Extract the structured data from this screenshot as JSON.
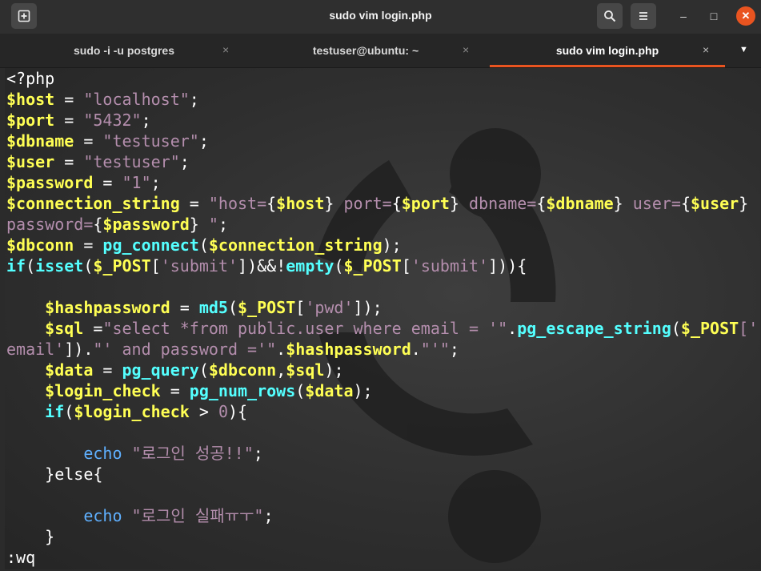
{
  "window": {
    "title": "sudo vim login.php",
    "new_tab_icon": "new-tab-icon",
    "search_icon": "search-icon",
    "menu_icon": "hamburger-icon",
    "minimize_glyph": "–",
    "maximize_glyph": "□",
    "close_glyph": "✕",
    "accent_color": "#e95420"
  },
  "tabs": [
    {
      "label": "sudo -i -u postgres",
      "active": false
    },
    {
      "label": "testuser@ubuntu: ~",
      "active": false
    },
    {
      "label": "sudo vim login.php",
      "active": true
    }
  ],
  "tab_close_glyph": "×",
  "tab_menu_glyph": "▼",
  "code": {
    "l01": {
      "a": "<?php"
    },
    "l02": {
      "a": "$host",
      "b": " = ",
      "c": "\"localhost\"",
      "d": ";"
    },
    "l03": {
      "a": "$port",
      "b": " = ",
      "c": "\"5432\"",
      "d": ";"
    },
    "l04": {
      "a": "$dbname",
      "b": " = ",
      "c": "\"testuser\"",
      "d": ";"
    },
    "l05": {
      "a": "$user",
      "b": " = ",
      "c": "\"testuser\"",
      "d": ";"
    },
    "l06": {
      "a": "$password",
      "b": " = ",
      "c": "\"1\"",
      "d": ";"
    },
    "l07": {
      "a": "$connection_string",
      "b": " = ",
      "c": "\"host=",
      "d": "{",
      "e": "$host",
      "f": "}",
      "g": " port=",
      "h": "{",
      "i": "$port",
      "j": "}",
      "k": " dbname=",
      "l": "{",
      "m": "$dbname",
      "n": "}",
      "o": " user=",
      "p": "{",
      "q": "$user",
      "r": "}"
    },
    "l08": {
      "a": "password=",
      "b": "{",
      "c": "$password",
      "d": "}",
      "e": " \"",
      "f": ";"
    },
    "l09": {
      "a": "$dbconn",
      "b": " = ",
      "c": "pg_connect",
      "d": "(",
      "e": "$connection_string",
      "f": ");"
    },
    "l10": {
      "a": "if",
      "b": "(",
      "c": "isset",
      "d": "(",
      "e": "$_POST",
      "f": "[",
      "g": "'submit'",
      "h": "])&&!",
      "i": "empty",
      "j": "(",
      "k": "$_POST",
      "l": "[",
      "m": "'submit'",
      "n": "])){"
    },
    "l12": {
      "a": "    ",
      "b": "$hashpassword",
      "c": " = ",
      "d": "md5",
      "e": "(",
      "f": "$_POST",
      "g": "[",
      "h": "'pwd'",
      "i": "]);"
    },
    "l13": {
      "a": "    ",
      "b": "$sql",
      "c": " =",
      "d": "\"select *from public.user where email = '\"",
      "e": ".",
      "f": "pg_escape_string",
      "g": "(",
      "h": "$_POST",
      "i": "['"
    },
    "l14": {
      "a": "email'",
      "b": "]).",
      "c": "\"' and password ='\"",
      "d": ".",
      "e": "$hashpassword",
      "f": ".",
      "g": "\"'\"",
      "h": ";"
    },
    "l15": {
      "a": "    ",
      "b": "$data",
      "c": " = ",
      "d": "pg_query",
      "e": "(",
      "f": "$dbconn",
      "g": ",",
      "h": "$sql",
      "i": ");"
    },
    "l16": {
      "a": "    ",
      "b": "$login_check",
      "c": " = ",
      "d": "pg_num_rows",
      "e": "(",
      "f": "$data",
      "g": ");"
    },
    "l17": {
      "a": "    ",
      "b": "if",
      "c": "(",
      "d": "$login_check",
      "e": " > ",
      "f": "0",
      "g": "){"
    },
    "l19": {
      "a": "        ",
      "b": "echo",
      "c": " ",
      "d": "\"로그인 성공!!\"",
      "e": ";"
    },
    "l20": {
      "a": "    ",
      "b": "}else{"
    },
    "l22": {
      "a": "        ",
      "b": "echo",
      "c": " ",
      "d": "\"로그인 실패ㅠㅜ\"",
      "e": ";"
    },
    "l23": {
      "a": "    ",
      "b": "}"
    },
    "l24": {
      "a": ":wq"
    }
  },
  "syntax_colors": {
    "variable": "#ffff54",
    "function": "#54ffff",
    "string": "#b48ead",
    "echo": "#5fb0ff",
    "plain": "#ffffff"
  },
  "background_logo": "ubuntu-circle-of-friends"
}
